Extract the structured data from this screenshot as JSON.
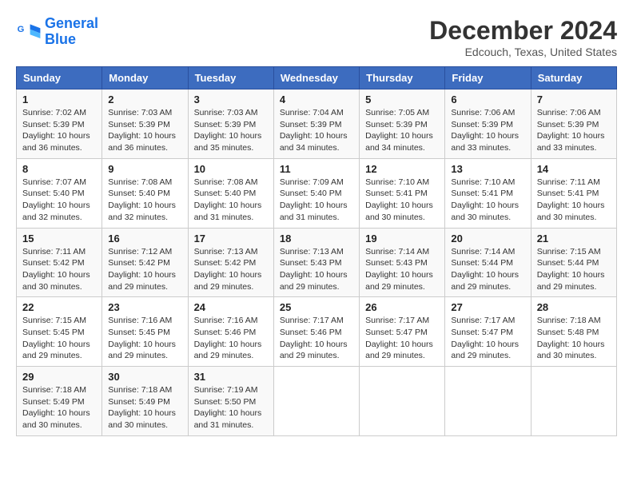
{
  "logo": {
    "line1": "General",
    "line2": "Blue"
  },
  "title": "December 2024",
  "location": "Edcouch, Texas, United States",
  "weekdays": [
    "Sunday",
    "Monday",
    "Tuesday",
    "Wednesday",
    "Thursday",
    "Friday",
    "Saturday"
  ],
  "weeks": [
    [
      {
        "day": "1",
        "sunrise": "7:02 AM",
        "sunset": "5:39 PM",
        "daylight": "10 hours and 36 minutes."
      },
      {
        "day": "2",
        "sunrise": "7:03 AM",
        "sunset": "5:39 PM",
        "daylight": "10 hours and 36 minutes."
      },
      {
        "day": "3",
        "sunrise": "7:03 AM",
        "sunset": "5:39 PM",
        "daylight": "10 hours and 35 minutes."
      },
      {
        "day": "4",
        "sunrise": "7:04 AM",
        "sunset": "5:39 PM",
        "daylight": "10 hours and 34 minutes."
      },
      {
        "day": "5",
        "sunrise": "7:05 AM",
        "sunset": "5:39 PM",
        "daylight": "10 hours and 34 minutes."
      },
      {
        "day": "6",
        "sunrise": "7:06 AM",
        "sunset": "5:39 PM",
        "daylight": "10 hours and 33 minutes."
      },
      {
        "day": "7",
        "sunrise": "7:06 AM",
        "sunset": "5:39 PM",
        "daylight": "10 hours and 33 minutes."
      }
    ],
    [
      {
        "day": "8",
        "sunrise": "7:07 AM",
        "sunset": "5:40 PM",
        "daylight": "10 hours and 32 minutes."
      },
      {
        "day": "9",
        "sunrise": "7:08 AM",
        "sunset": "5:40 PM",
        "daylight": "10 hours and 32 minutes."
      },
      {
        "day": "10",
        "sunrise": "7:08 AM",
        "sunset": "5:40 PM",
        "daylight": "10 hours and 31 minutes."
      },
      {
        "day": "11",
        "sunrise": "7:09 AM",
        "sunset": "5:40 PM",
        "daylight": "10 hours and 31 minutes."
      },
      {
        "day": "12",
        "sunrise": "7:10 AM",
        "sunset": "5:41 PM",
        "daylight": "10 hours and 30 minutes."
      },
      {
        "day": "13",
        "sunrise": "7:10 AM",
        "sunset": "5:41 PM",
        "daylight": "10 hours and 30 minutes."
      },
      {
        "day": "14",
        "sunrise": "7:11 AM",
        "sunset": "5:41 PM",
        "daylight": "10 hours and 30 minutes."
      }
    ],
    [
      {
        "day": "15",
        "sunrise": "7:11 AM",
        "sunset": "5:42 PM",
        "daylight": "10 hours and 30 minutes."
      },
      {
        "day": "16",
        "sunrise": "7:12 AM",
        "sunset": "5:42 PM",
        "daylight": "10 hours and 29 minutes."
      },
      {
        "day": "17",
        "sunrise": "7:13 AM",
        "sunset": "5:42 PM",
        "daylight": "10 hours and 29 minutes."
      },
      {
        "day": "18",
        "sunrise": "7:13 AM",
        "sunset": "5:43 PM",
        "daylight": "10 hours and 29 minutes."
      },
      {
        "day": "19",
        "sunrise": "7:14 AM",
        "sunset": "5:43 PM",
        "daylight": "10 hours and 29 minutes."
      },
      {
        "day": "20",
        "sunrise": "7:14 AM",
        "sunset": "5:44 PM",
        "daylight": "10 hours and 29 minutes."
      },
      {
        "day": "21",
        "sunrise": "7:15 AM",
        "sunset": "5:44 PM",
        "daylight": "10 hours and 29 minutes."
      }
    ],
    [
      {
        "day": "22",
        "sunrise": "7:15 AM",
        "sunset": "5:45 PM",
        "daylight": "10 hours and 29 minutes."
      },
      {
        "day": "23",
        "sunrise": "7:16 AM",
        "sunset": "5:45 PM",
        "daylight": "10 hours and 29 minutes."
      },
      {
        "day": "24",
        "sunrise": "7:16 AM",
        "sunset": "5:46 PM",
        "daylight": "10 hours and 29 minutes."
      },
      {
        "day": "25",
        "sunrise": "7:17 AM",
        "sunset": "5:46 PM",
        "daylight": "10 hours and 29 minutes."
      },
      {
        "day": "26",
        "sunrise": "7:17 AM",
        "sunset": "5:47 PM",
        "daylight": "10 hours and 29 minutes."
      },
      {
        "day": "27",
        "sunrise": "7:17 AM",
        "sunset": "5:47 PM",
        "daylight": "10 hours and 29 minutes."
      },
      {
        "day": "28",
        "sunrise": "7:18 AM",
        "sunset": "5:48 PM",
        "daylight": "10 hours and 30 minutes."
      }
    ],
    [
      {
        "day": "29",
        "sunrise": "7:18 AM",
        "sunset": "5:49 PM",
        "daylight": "10 hours and 30 minutes."
      },
      {
        "day": "30",
        "sunrise": "7:18 AM",
        "sunset": "5:49 PM",
        "daylight": "10 hours and 30 minutes."
      },
      {
        "day": "31",
        "sunrise": "7:19 AM",
        "sunset": "5:50 PM",
        "daylight": "10 hours and 31 minutes."
      },
      null,
      null,
      null,
      null
    ]
  ]
}
